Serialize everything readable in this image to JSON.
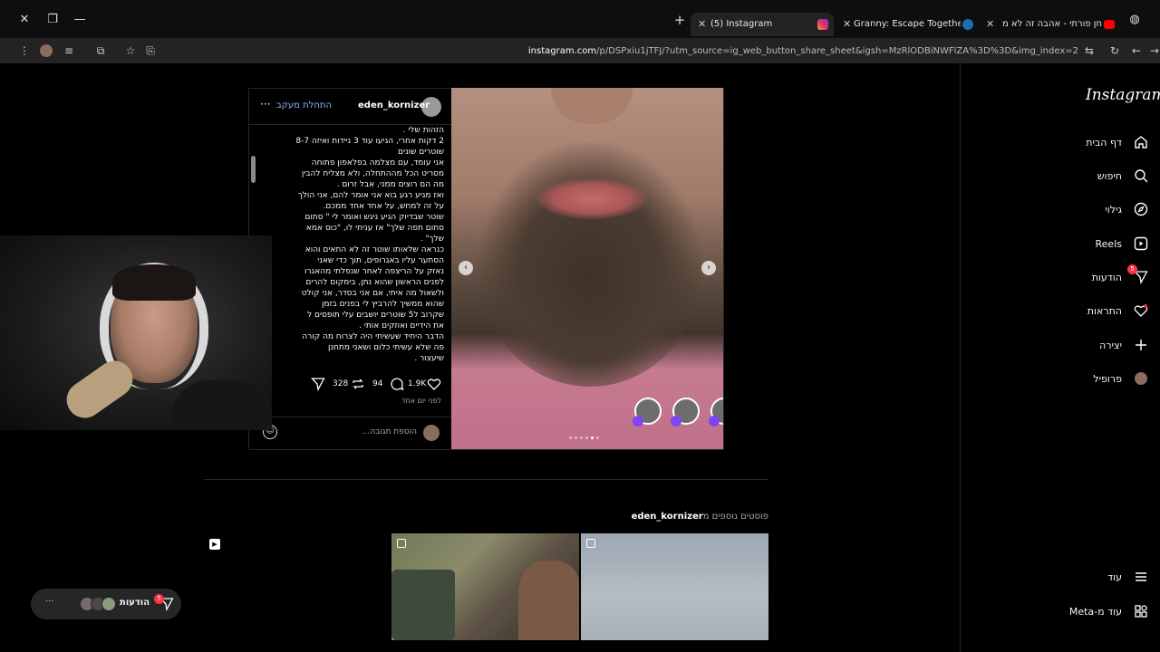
{
  "tabs": [
    {
      "title": "(5) Instagram",
      "active": true
    },
    {
      "title": "Granny: Escape Together on Steam",
      "active": false
    },
    {
      "title": "חן פורתי - אהבה זה לא מספיק",
      "active": false
    }
  ],
  "address": {
    "domain": "instagram.com",
    "path": "/p/DSPxiu1jTFJ/?utm_source=ig_web_button_share_sheet&igsh=MzRlODBiNWFlZA%3D%3D&img_index=2"
  },
  "sidebar": {
    "logo": "Instagram",
    "items": [
      {
        "label": "דף הבית",
        "icon": "home-icon"
      },
      {
        "label": "חיפוש",
        "icon": "search-icon"
      },
      {
        "label": "גילוי",
        "icon": "compass-icon"
      },
      {
        "label": "Reels",
        "icon": "reels-icon"
      },
      {
        "label": "הודעות",
        "icon": "messenger-icon",
        "badge": "5"
      },
      {
        "label": "התראות",
        "icon": "heart-icon"
      },
      {
        "label": "יצירה",
        "icon": "plus-icon"
      },
      {
        "label": "פרופיל",
        "icon": "avatar-icon"
      }
    ],
    "bottom": [
      {
        "label": "עוד",
        "icon": "menu-icon"
      },
      {
        "label": "עוד מ-Meta",
        "icon": "meta-icon"
      }
    ]
  },
  "post": {
    "username": "eden_kornizer",
    "follow": "התחלת מעקב",
    "caption_lines": [
      "הזהות שלי .",
      "2 דקות אחרי, הגיעו עוד 3 ניידות ואיזה 8-7",
      "שוטרים שונים",
      "אני עומד, עם מצלמה בפלאפון פתוחה",
      "מסריט הכל מההתחלה, ולא מצליח להבין",
      "מה הם רוצים ממני, אבל זרום .",
      "ואז מגיע רגע בוא אני אומר להם, אני הולך",
      "על זה למחש, על אחד אחד ממכם.",
      "שוטר שבדיוק הגיע ניגש ואומר לי \" סתום",
      "סתום תפה שלך\" אז עניתי לו, \"כוס אמא",
      "שלך\" .",
      "כנראה שלאותו שוטר זה לא התאים והוא",
      "הסתער עליו באגרופים, תוך כדי שאני",
      "נאזק על הריצפה לאחר שנפלתי מהאגרו",
      "לפנים הראשון שהוא נתן, בימקום להרים",
      "ולשאול מה איתי, אם אני בסדר, אני קולט",
      "שהוא ממשיך להרביץ לי בפנים בזמן",
      "שקרוב ל5 שוטרים יושבים עלי תופסים ל",
      "את הידיים ואוזקים אותי .",
      "הדבר היחיד שעשיתי היה לצרוח מה קורה",
      "פה שלא עשיתי כלום ושאני מתחנן",
      "שיעצור ."
    ],
    "likes": "1.9K",
    "comments": "94",
    "reposts": "328",
    "time": "לפני יום אחד",
    "comment_placeholder": "הוספת תגובה..."
  },
  "more": {
    "prefix": "פוסטים נוספים מ",
    "username": "eden_kornizer"
  },
  "messages_pill": {
    "label": "הודעות",
    "badge": "5"
  }
}
